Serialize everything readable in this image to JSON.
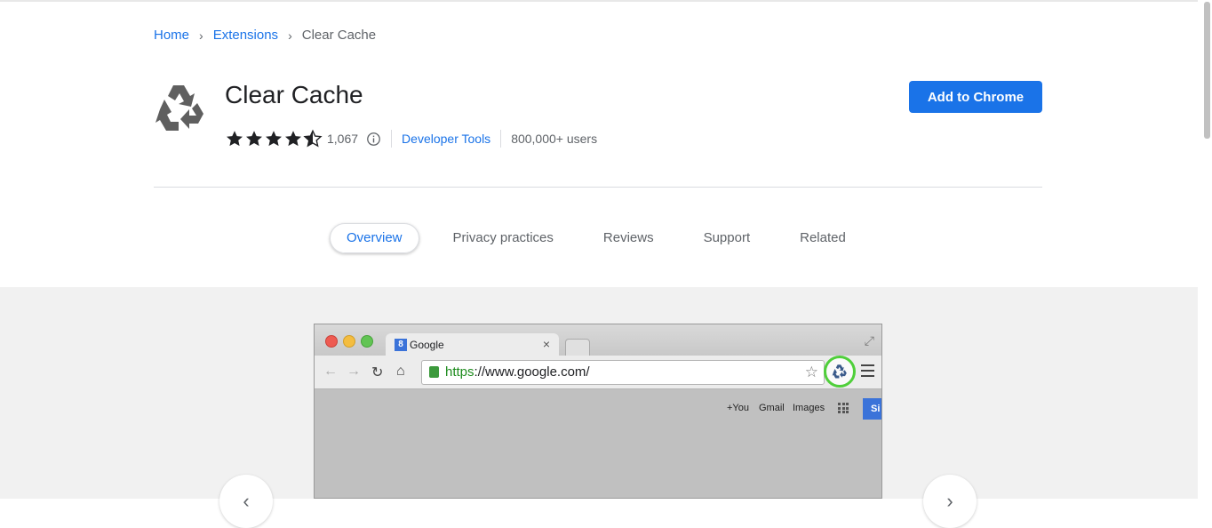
{
  "breadcrumb": {
    "home": "Home",
    "extensions": "Extensions",
    "current": "Clear Cache"
  },
  "extension": {
    "title": "Clear Cache",
    "rating_value": 4.5,
    "rating_count": "1,067",
    "category": "Developer Tools",
    "users": "800,000+ users",
    "add_button": "Add to Chrome"
  },
  "tabs": [
    {
      "label": "Overview",
      "active": true
    },
    {
      "label": "Privacy practices",
      "active": false
    },
    {
      "label": "Reviews",
      "active": false
    },
    {
      "label": "Support",
      "active": false
    },
    {
      "label": "Related",
      "active": false
    }
  ],
  "screenshot": {
    "tab_favicon": "8",
    "tab_title": "Google",
    "tab_close": "×",
    "url_scheme": "https",
    "url_rest": "://www.google.com/",
    "links": {
      "plus_you": "+You",
      "gmail": "Gmail",
      "images": "Images"
    },
    "sign_in": "Si"
  },
  "icons": {
    "logo": "recycle-icon",
    "info": "info-icon",
    "prev": "chevron-left-icon",
    "next": "chevron-right-icon"
  },
  "colors": {
    "accent": "#1a73e8",
    "text": "#202124",
    "muted": "#5f6368",
    "highlight_ring": "#4fcf3a"
  }
}
